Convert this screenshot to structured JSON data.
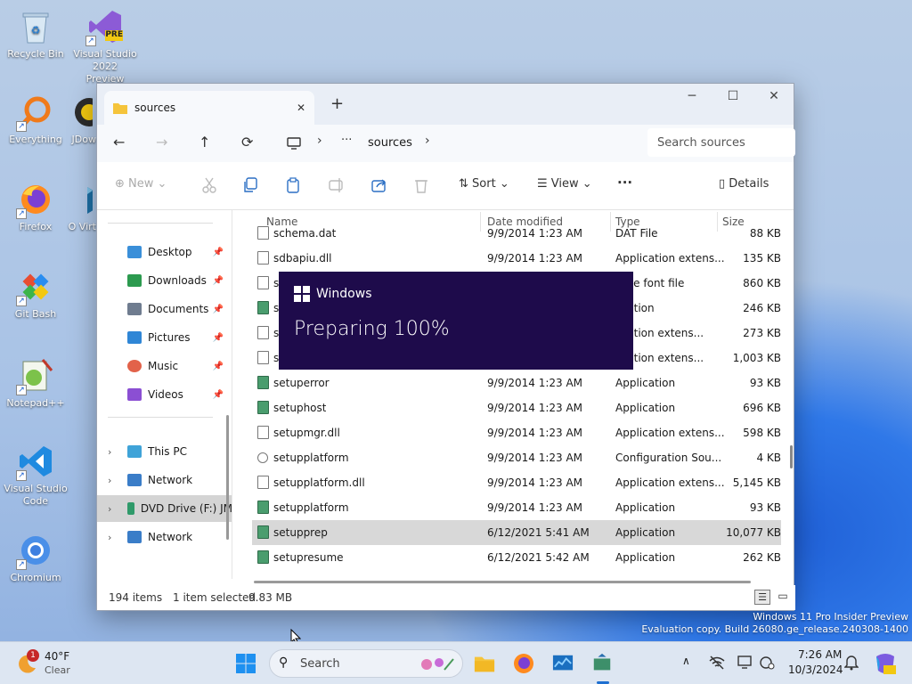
{
  "desktop": {
    "icons": [
      {
        "label": "Recycle Bin"
      },
      {
        "label": "Visual Studio 2022 Preview",
        "badge": "PRE"
      },
      {
        "label": "Everything"
      },
      {
        "label": "JDow"
      },
      {
        "label": "Firefox"
      },
      {
        "label": "O Virt"
      },
      {
        "label": "Git Bash"
      },
      {
        "label": "Notepad++"
      },
      {
        "label": "Visual Studio Code"
      },
      {
        "label": "Chromium"
      }
    ]
  },
  "explorer": {
    "tab_title": "sources",
    "new_tab": "+",
    "window_controls": {
      "minimize": "─",
      "maximize": "☐",
      "close": "✕"
    },
    "nav": {
      "back": "←",
      "forward": "→",
      "up": "↑",
      "refresh": "⟳",
      "overflow": "···",
      "crumb": "sources",
      "crumb_sep": "›"
    },
    "search_placeholder": "Search sources",
    "toolbar": {
      "new": "New",
      "sort": "Sort",
      "view": "View",
      "more": "···",
      "details": "Details"
    },
    "sidebar": {
      "pinned": [
        {
          "label": "Desktop",
          "color": "#3a8fd9"
        },
        {
          "label": "Downloads",
          "color": "#2c9a4f"
        },
        {
          "label": "Documents",
          "color": "#6f7c8f"
        },
        {
          "label": "Pictures",
          "color": "#2f86d6"
        },
        {
          "label": "Music",
          "color": "#e2624a"
        },
        {
          "label": "Videos",
          "color": "#8b4fd3"
        }
      ],
      "locations": [
        {
          "label": "This PC",
          "color": "#3fa3d8"
        },
        {
          "label": "Network",
          "color": "#3a7dc8"
        },
        {
          "label": "DVD Drive (F:) JM",
          "color": "#2f9a6a"
        },
        {
          "label": "Network",
          "color": "#3a7dc8"
        }
      ]
    },
    "columns": {
      "name": "Name",
      "date": "Date modified",
      "type": "Type",
      "size": "Size"
    },
    "files": [
      {
        "name": "schema.dat",
        "date": "9/9/2014 1:23 AM",
        "type": "DAT File",
        "size": "88 KB",
        "icon": "file"
      },
      {
        "name": "sdbapiu.dll",
        "date": "9/9/2014 1:23 AM",
        "type": "Application extens...",
        "size": "135 KB",
        "icon": "file"
      },
      {
        "name": "s",
        "date": "",
        "type": "Type font file",
        "size": "860 KB",
        "icon": "file"
      },
      {
        "name": "s",
        "date": "",
        "type": "lication",
        "size": "246 KB",
        "icon": "app"
      },
      {
        "name": "s",
        "date": "",
        "type": "lication extens...",
        "size": "273 KB",
        "icon": "file"
      },
      {
        "name": "s",
        "date": "",
        "type": "lication extens...",
        "size": "1,003 KB",
        "icon": "file"
      },
      {
        "name": "setuperror",
        "date": "9/9/2014 1:23 AM",
        "type": "Application",
        "size": "93 KB",
        "icon": "app"
      },
      {
        "name": "setuphost",
        "date": "9/9/2014 1:23 AM",
        "type": "Application",
        "size": "696 KB",
        "icon": "app"
      },
      {
        "name": "setupmgr.dll",
        "date": "9/9/2014 1:23 AM",
        "type": "Application extens...",
        "size": "598 KB",
        "icon": "file"
      },
      {
        "name": "setupplatform",
        "date": "9/9/2014 1:23 AM",
        "type": "Configuration Sou...",
        "size": "4 KB",
        "icon": "cfg"
      },
      {
        "name": "setupplatform.dll",
        "date": "9/9/2014 1:23 AM",
        "type": "Application extens...",
        "size": "5,145 KB",
        "icon": "file"
      },
      {
        "name": "setupplatform",
        "date": "9/9/2014 1:23 AM",
        "type": "Application",
        "size": "93 KB",
        "icon": "app"
      },
      {
        "name": "setupprep",
        "date": "6/12/2021 5:41 AM",
        "type": "Application",
        "size": "10,077 KB",
        "icon": "app",
        "selected": true
      },
      {
        "name": "setupresume",
        "date": "6/12/2021 5:42 AM",
        "type": "Application",
        "size": "262 KB",
        "icon": "app"
      }
    ],
    "status": {
      "items": "194 items",
      "selected": "1 item selected",
      "size": "9.83 MB"
    }
  },
  "setup_overlay": {
    "brand": "Windows",
    "message": "Preparing 100%",
    "progress_percent": 100
  },
  "watermark": {
    "line1": "Windows 11 Pro Insider Preview",
    "line2": "Evaluation copy. Build 26080.ge_release.240308-1400"
  },
  "taskbar": {
    "weather": {
      "temp": "40°F",
      "condition": "Clear",
      "badge": "1"
    },
    "search_label": "Search",
    "tray_chevron": "∧",
    "clock": {
      "time": "7:26 AM",
      "date": "10/3/2024"
    }
  }
}
